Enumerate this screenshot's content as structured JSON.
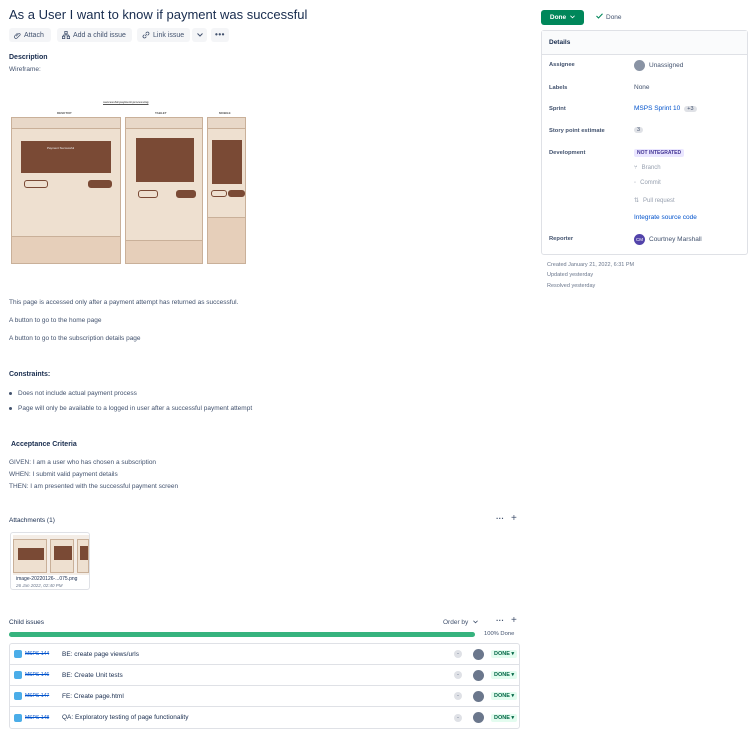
{
  "issue": {
    "title": "As a User I want to know if payment was successful"
  },
  "toolbar": {
    "attach_label": "Attach",
    "add_child_label": "Add a child issue",
    "link_issue_label": "Link issue"
  },
  "description": {
    "heading": "Description",
    "wireframe_label": "Wireframe:",
    "wireframe_caption": "successful payment processing",
    "wireframe_sublabels": [
      "DESKTOP",
      "TABLET",
      "MOBILE"
    ],
    "wireframe_panel_text": "Payment Successful",
    "paragraphs": [
      "This page is accessed only after a payment attempt has returned as successful.",
      "A button to go to the home page",
      "A button to go to the subscription details page"
    ],
    "constraints_heading": "Constraints:",
    "constraints": [
      "Does not include actual payment process",
      "Page will only be available to a logged in user after a successful payment attempt"
    ],
    "acceptance_heading": "Acceptance Criteria",
    "acceptance": [
      "GIVEN: I am a user who has chosen a subscription",
      "WHEN: I submit valid payment details",
      "THEN: I am presented with the successful payment screen"
    ]
  },
  "attachments": {
    "heading": "Attachments (1)",
    "file_name": "image-20220126-...075.png",
    "file_date": "26 Jan 2022, 02:40 PM"
  },
  "child_issues": {
    "heading": "Child issues",
    "order_by_label": "Order by",
    "progress": 1.0,
    "progress_label": "100% Done",
    "items": [
      {
        "key": "MSPS-144",
        "summary": "BE: create page views/urls",
        "status": "DONE"
      },
      {
        "key": "MSPS-146",
        "summary": "BE: Create Unit tests",
        "status": "DONE"
      },
      {
        "key": "MSPS-147",
        "summary": "FE: Create page.html",
        "status": "DONE"
      },
      {
        "key": "MSPS-148",
        "summary": "QA: Exploratory testing of page functionality",
        "status": "DONE"
      }
    ]
  },
  "status": {
    "button_label": "Done",
    "resolution_label": "Done",
    "color": "#00875a"
  },
  "details": {
    "heading": "Details",
    "assignee_label": "Assignee",
    "assignee_value": "Unassigned",
    "labels_label": "Labels",
    "labels_value": "None",
    "sprint_label": "Sprint",
    "sprint_value": "MSPS Sprint 10",
    "sprint_extra": "+3",
    "story_points_label": "Story point estimate",
    "story_points_value": "3",
    "development_label": "Development",
    "development_status": "NOT INTEGRATED",
    "branch_label": "Branch",
    "commit_label": "Commit",
    "pull_request_label": "Pull request",
    "integrate_label": "Integrate source code",
    "reporter_label": "Reporter",
    "reporter_initials": "CM",
    "reporter_value": "Courtney Marshall"
  },
  "meta": {
    "created": "Created January 21, 2022, 6:31 PM",
    "updated": "Updated yesterday",
    "resolved": "Resolved yesterday"
  }
}
